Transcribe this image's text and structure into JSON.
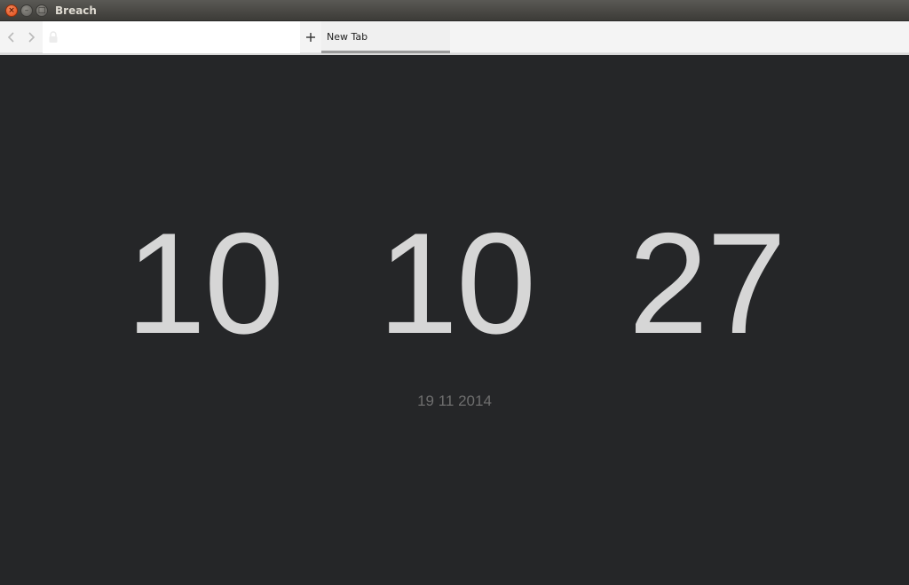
{
  "window": {
    "title": "Breach",
    "close_glyph": "×",
    "minimize_glyph": "–",
    "maximize_glyph": "□"
  },
  "toolbar": {
    "back_icon": "chevron-left-icon",
    "forward_icon": "chevron-right-icon",
    "lock_icon": "lock-icon",
    "address_value": "",
    "address_placeholder": "",
    "new_tab_glyph": "+"
  },
  "tabs": [
    {
      "label": "New Tab",
      "active": true
    }
  ],
  "clock": {
    "hours": "10",
    "minutes": "10",
    "seconds": "27",
    "date": "19 11 2014"
  },
  "colors": {
    "content_background": "#252628",
    "clock_text": "#d6d6d6",
    "date_text": "#6e6e6e",
    "close_button": "#df4a16"
  }
}
